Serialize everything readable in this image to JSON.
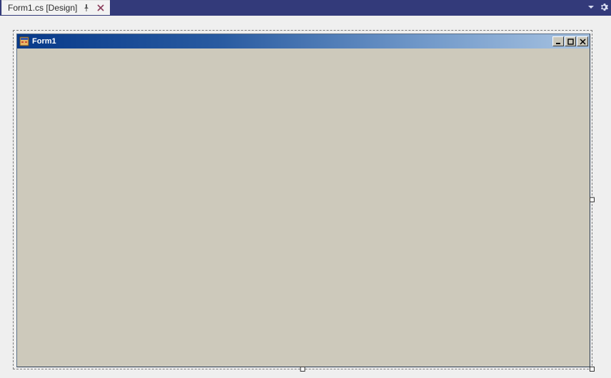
{
  "tab": {
    "label": "Form1.cs [Design]"
  },
  "form": {
    "title": "Form1"
  }
}
